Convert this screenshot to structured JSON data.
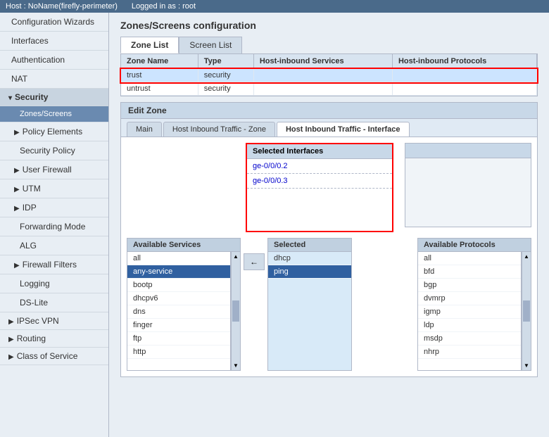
{
  "topbar": {
    "host_label": "Host : NoName(firefly-perimeter)",
    "logged_label": "Logged in as : root"
  },
  "sidebar": {
    "items": [
      {
        "id": "config-wizards",
        "label": "Configuration Wizards",
        "indent": 1,
        "active": false
      },
      {
        "id": "interfaces",
        "label": "Interfaces",
        "indent": 1,
        "active": false
      },
      {
        "id": "authentication",
        "label": "Authentication",
        "indent": 1,
        "active": false
      },
      {
        "id": "nat",
        "label": "NAT",
        "indent": 1,
        "active": false
      },
      {
        "id": "security",
        "label": "Security",
        "indent": 0,
        "active": true,
        "group": true
      },
      {
        "id": "zones-screens",
        "label": "Zones/Screens",
        "indent": 2,
        "active": true,
        "sub": true
      },
      {
        "id": "policy-elements",
        "label": "Policy Elements",
        "indent": 1,
        "active": false
      },
      {
        "id": "security-policy",
        "label": "Security Policy",
        "indent": 2,
        "active": false
      },
      {
        "id": "user-firewall",
        "label": "User Firewall",
        "indent": 1,
        "active": false
      },
      {
        "id": "utm",
        "label": "UTM",
        "indent": 1,
        "active": false
      },
      {
        "id": "idp",
        "label": "IDP",
        "indent": 1,
        "active": false
      },
      {
        "id": "forwarding-mode",
        "label": "Forwarding Mode",
        "indent": 2,
        "active": false
      },
      {
        "id": "alg",
        "label": "ALG",
        "indent": 2,
        "active": false
      },
      {
        "id": "firewall-filters",
        "label": "Firewall Filters",
        "indent": 1,
        "active": false
      },
      {
        "id": "logging",
        "label": "Logging",
        "indent": 2,
        "active": false
      },
      {
        "id": "ds-lite",
        "label": "DS-Lite",
        "indent": 2,
        "active": false
      },
      {
        "id": "ipsec-vpn",
        "label": "IPSec VPN",
        "indent": 0,
        "active": false
      },
      {
        "id": "routing",
        "label": "Routing",
        "indent": 0,
        "active": false
      },
      {
        "id": "class-of-service",
        "label": "Class of Service",
        "indent": 0,
        "active": false
      }
    ]
  },
  "page": {
    "title": "Zones/Screens configuration"
  },
  "zone_tabs": [
    {
      "id": "zone-list",
      "label": "Zone List",
      "active": true
    },
    {
      "id": "screen-list",
      "label": "Screen List",
      "active": false
    }
  ],
  "zone_table": {
    "headers": [
      "Zone Name",
      "Type",
      "Host-inbound Services",
      "Host-inbound Protocols"
    ],
    "rows": [
      {
        "name": "trust",
        "type": "security",
        "host_services": "",
        "host_protocols": "",
        "highlighted": true
      },
      {
        "name": "untrust",
        "type": "security",
        "host_services": "",
        "host_protocols": "",
        "highlighted": false
      }
    ]
  },
  "edit_zone": {
    "title": "Edit Zone",
    "tabs": [
      {
        "id": "main",
        "label": "Main",
        "active": false
      },
      {
        "id": "host-inbound-zone",
        "label": "Host Inbound Traffic - Zone",
        "active": false
      },
      {
        "id": "host-inbound-interface",
        "label": "Host Inbound Traffic - Interface",
        "active": true
      }
    ]
  },
  "selected_interfaces": {
    "header": "Selected Interfaces",
    "items": [
      "ge-0/0/0.2",
      "ge-0/0/0.3"
    ]
  },
  "available_services": {
    "label": "Available Services",
    "items": [
      "all",
      "any-service",
      "bootp",
      "dhcpv6",
      "dns",
      "finger",
      "ftp",
      "http"
    ]
  },
  "selected_services": {
    "label": "Selected",
    "items": [
      {
        "value": "dhcp",
        "selected": false
      },
      {
        "value": "ping",
        "selected": true
      }
    ]
  },
  "available_protocols": {
    "label": "Available Protocols",
    "items": [
      "all",
      "bfd",
      "bgp",
      "dvmrp",
      "igmp",
      "ldp",
      "msdp",
      "nhrp"
    ]
  },
  "arrow_button": {
    "label": "←"
  }
}
